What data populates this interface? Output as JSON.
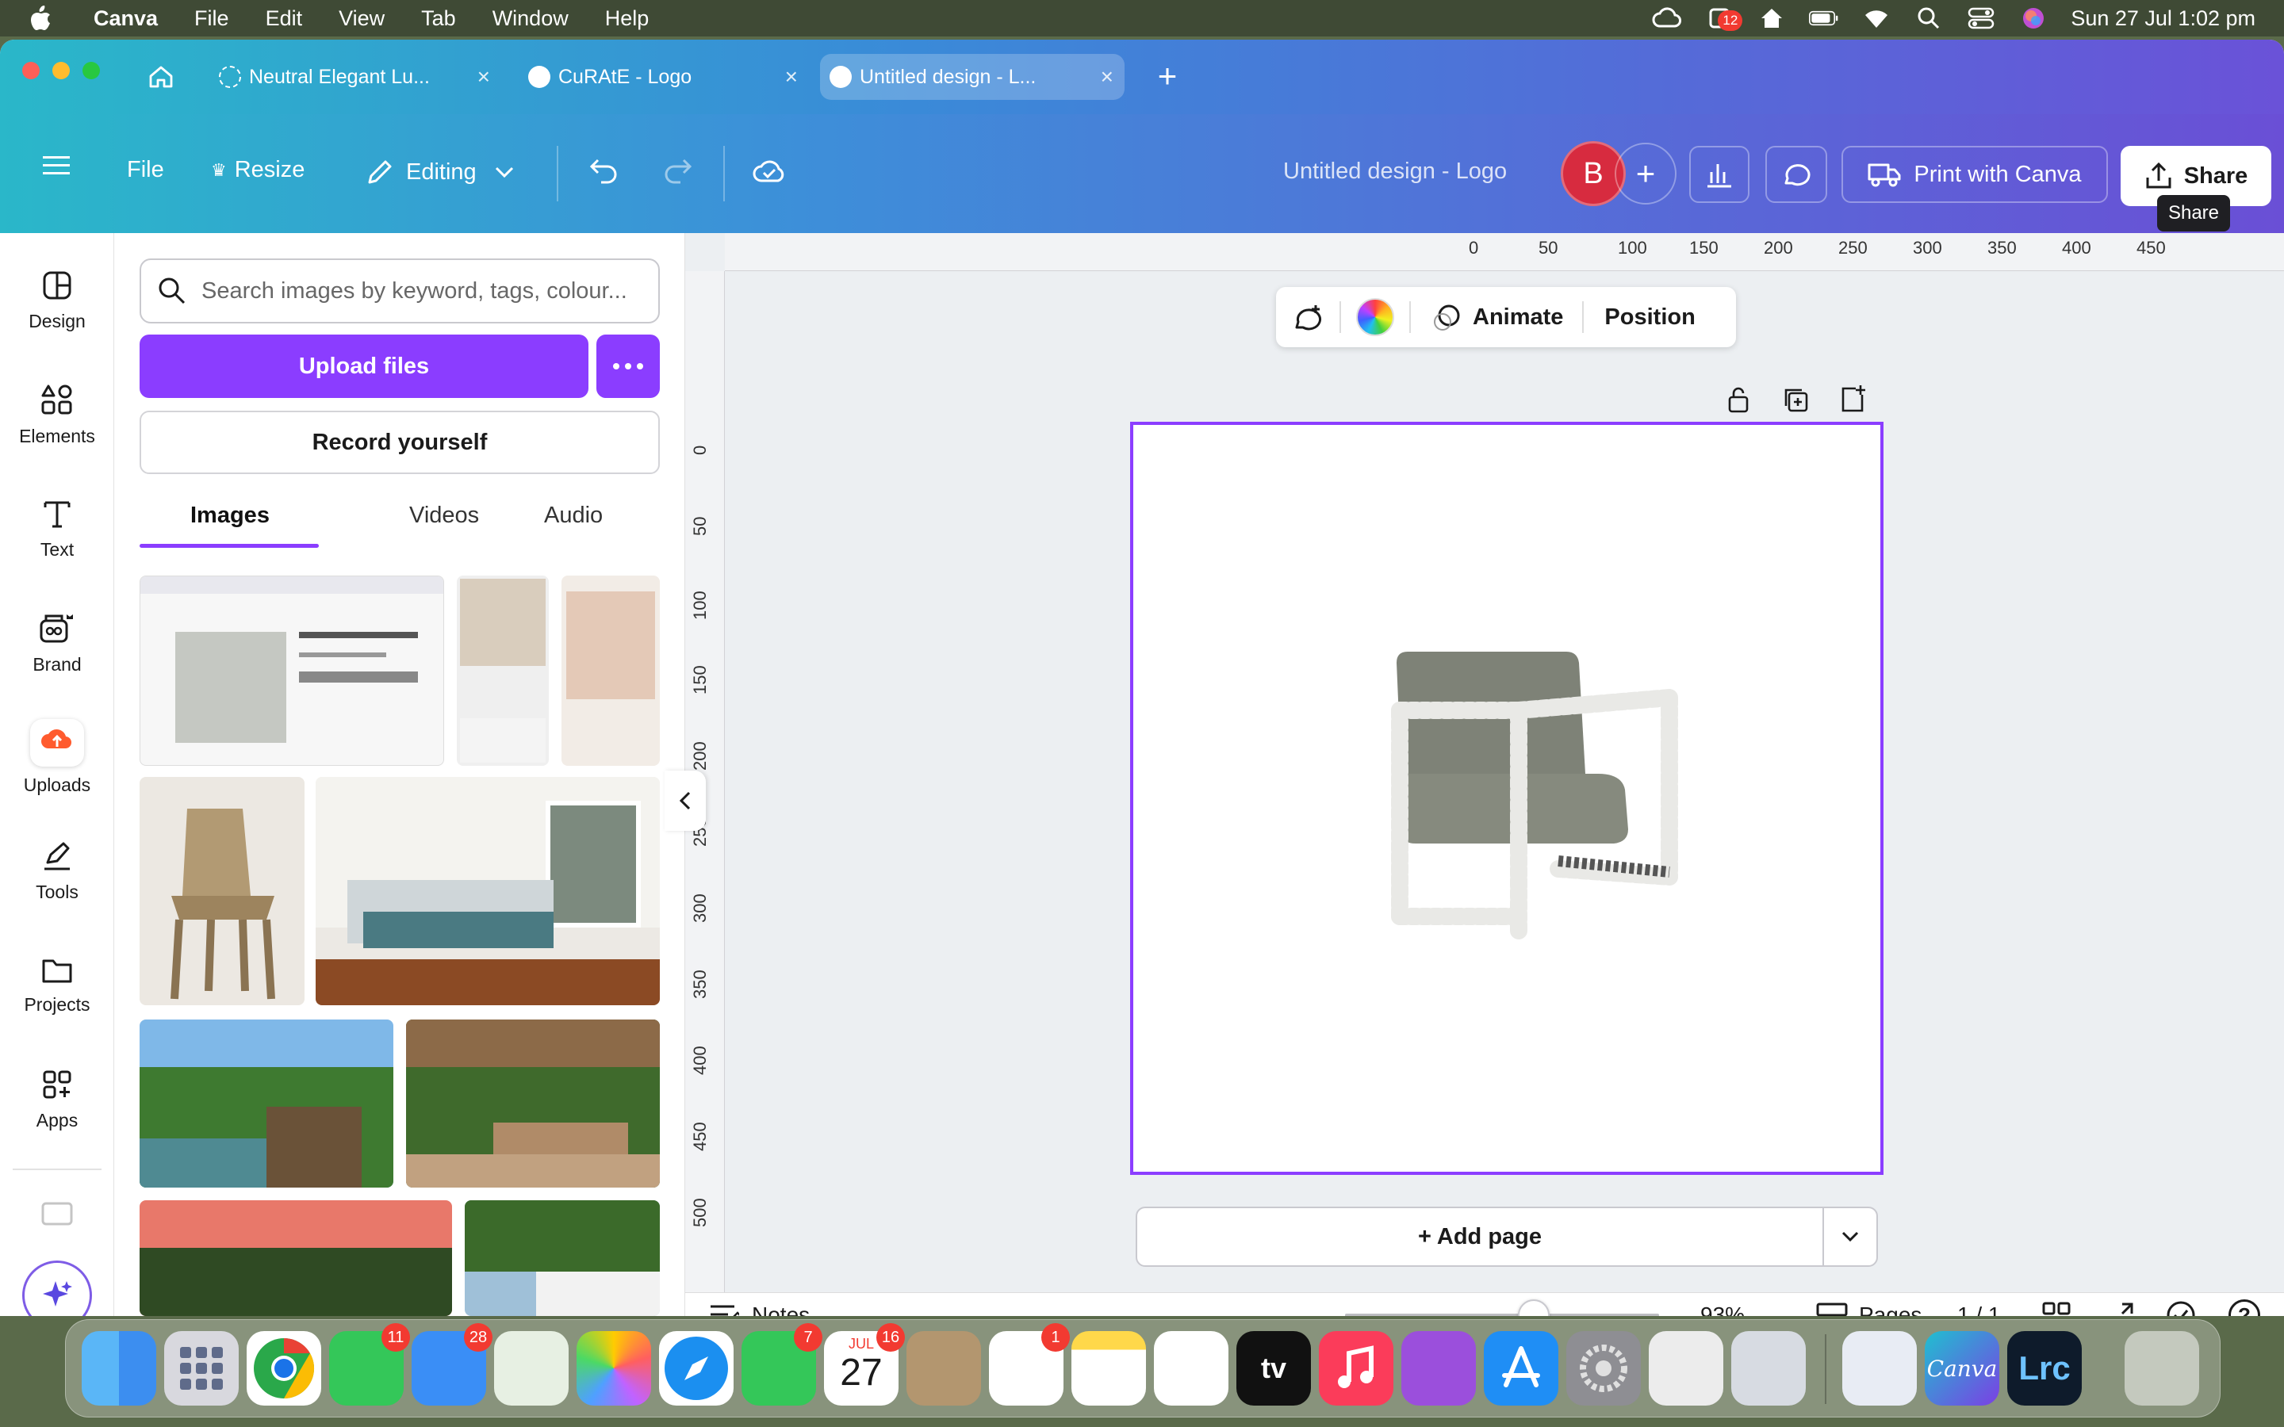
{
  "menubar": {
    "app": "Canva",
    "items": [
      "File",
      "Edit",
      "View",
      "Tab",
      "Window",
      "Help"
    ],
    "clock": "Sun 27 Jul  1:02 pm",
    "notif_badge": "12"
  },
  "tabs": [
    {
      "label": "Neutral Elegant Lu..."
    },
    {
      "label": "CuRAtE - Logo"
    },
    {
      "label": "Untitled design - L..."
    }
  ],
  "toolbar": {
    "file": "File",
    "resize": "Resize",
    "editing": "Editing",
    "doc_title": "Untitled design - Logo",
    "avatar": "B",
    "print": "Print with Canva",
    "share": "Share",
    "share_tooltip": "Share"
  },
  "rail": [
    {
      "label": "Design"
    },
    {
      "label": "Elements"
    },
    {
      "label": "Text"
    },
    {
      "label": "Brand"
    },
    {
      "label": "Uploads"
    },
    {
      "label": "Tools"
    },
    {
      "label": "Projects"
    },
    {
      "label": "Apps"
    }
  ],
  "panel": {
    "search_placeholder": "Search images by keyword, tags, colour...",
    "upload": "Upload files",
    "record": "Record yourself",
    "tabs": [
      "Images",
      "Videos",
      "Audio"
    ]
  },
  "ruler": {
    "top": [
      "0",
      "50",
      "100",
      "150",
      "200",
      "250",
      "300",
      "350",
      "400",
      "450"
    ],
    "left": [
      "0",
      "50",
      "100",
      "150",
      "200",
      "250",
      "300",
      "350",
      "400",
      "450",
      "500"
    ]
  },
  "context": {
    "animate": "Animate",
    "position": "Position"
  },
  "canvas": {
    "add_page": "+ Add page"
  },
  "status": {
    "notes": "Notes",
    "zoom": "93%",
    "zoom_fraction": 0.6,
    "pages": "Pages",
    "page_count": "1 / 1"
  },
  "dock": {
    "messages_badge": "11",
    "mail_badge": "28",
    "facetime_badge": "7",
    "calendar_month": "JUL",
    "calendar_day": "27",
    "calendar_badge": "16",
    "reminders_badge": "1",
    "tv_label": "tv",
    "canva_label": "Canva",
    "lrc_label": "Lrc"
  }
}
